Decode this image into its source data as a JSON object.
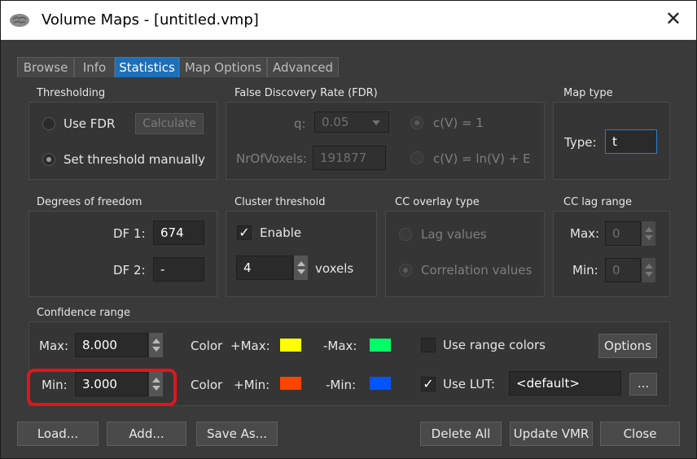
{
  "window": {
    "title": "Volume Maps - [untitled.vmp]",
    "close_glyph": "✕"
  },
  "tabs": [
    {
      "label": "Browse"
    },
    {
      "label": "Info"
    },
    {
      "label": "Statistics"
    },
    {
      "label": "Map Options"
    },
    {
      "label": "Advanced"
    }
  ],
  "thresholding": {
    "group": "Thresholding",
    "use_fdr": "Use FDR",
    "calculate": "Calculate",
    "set_manually": "Set threshold manually"
  },
  "fdr": {
    "group": "False Discovery Rate (FDR)",
    "q_label": "q:",
    "q_value": "0.05",
    "nvox_label": "NrOfVoxels:",
    "nvox_value": "191877",
    "cv1": "c(V) = 1",
    "cv2": "c(V) = ln(V) + E"
  },
  "map_type": {
    "group": "Map type",
    "label": "Type:",
    "value": "t"
  },
  "dof": {
    "group": "Degrees of freedom",
    "df1_label": "DF 1:",
    "df1_value": "674",
    "df2_label": "DF 2:",
    "df2_value": "-"
  },
  "cluster": {
    "group": "Cluster threshold",
    "enable": "Enable",
    "value": "4",
    "unit": "voxels"
  },
  "cc_overlay": {
    "group": "CC overlay type",
    "lag": "Lag values",
    "corr": "Correlation values"
  },
  "cc_lag": {
    "group": "CC lag range",
    "max_label": "Max:",
    "max_value": "0",
    "min_label": "Min:",
    "min_value": "0"
  },
  "confidence": {
    "group": "Confidence range",
    "max_label": "Max:",
    "max_value": "8.000",
    "min_label": "Min:",
    "min_value": "3.000",
    "color_label": "Color",
    "pmax": "+Max:",
    "nmax": "-Max:",
    "pmin": "+Min:",
    "nmin": "-Min:",
    "colors": {
      "pmax": "#ffff00",
      "nmax": "#00ff66",
      "pmin": "#ff4400",
      "nmin": "#0055ff"
    },
    "use_range_colors": "Use range colors",
    "options": "Options",
    "use_lut": "Use LUT:",
    "lut_value": "<default>",
    "lut_browse": "..."
  },
  "footer": {
    "load": "Load...",
    "add": "Add...",
    "save_as": "Save As...",
    "delete_all": "Delete All",
    "update_vmr": "Update VMR",
    "close": "Close"
  }
}
